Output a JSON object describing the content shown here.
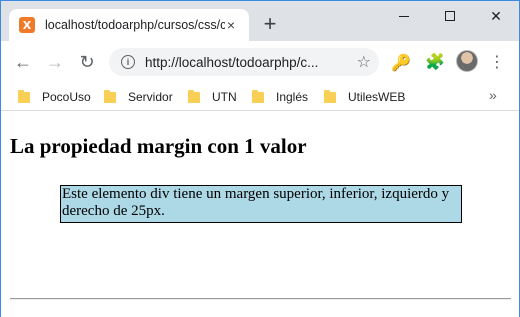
{
  "tab": {
    "favicon_letter": "X",
    "title": "localhost/todoarphp/cursos/css/c",
    "close_glyph": "×",
    "new_tab_glyph": "+"
  },
  "window_controls": {
    "close_glyph": "✕"
  },
  "toolbar": {
    "back_glyph": "←",
    "forward_glyph": "→",
    "reload_glyph": "↻",
    "info_glyph": "i",
    "url": "http://localhost/todoarphp/c...",
    "star_glyph": "☆",
    "key_glyph": "🔑",
    "puzzle_glyph": "🧩",
    "menu_glyph": "⋮"
  },
  "bookmarks": {
    "items": [
      {
        "label": "PocoUso"
      },
      {
        "label": "Servidor"
      },
      {
        "label": "UTN"
      },
      {
        "label": "Inglés"
      },
      {
        "label": "UtilesWEB"
      }
    ],
    "more_glyph": "»"
  },
  "page": {
    "heading": "La propiedad margin con 1 valor",
    "box_text": "Este elemento div tiene un margen superior, inferior, izquierdo y derecho de 25px."
  },
  "colors": {
    "box_bg": "#add8e6",
    "tabstrip_bg": "#dee1e6",
    "folder": "#f9cf56",
    "favicon": "#f07a2a"
  }
}
